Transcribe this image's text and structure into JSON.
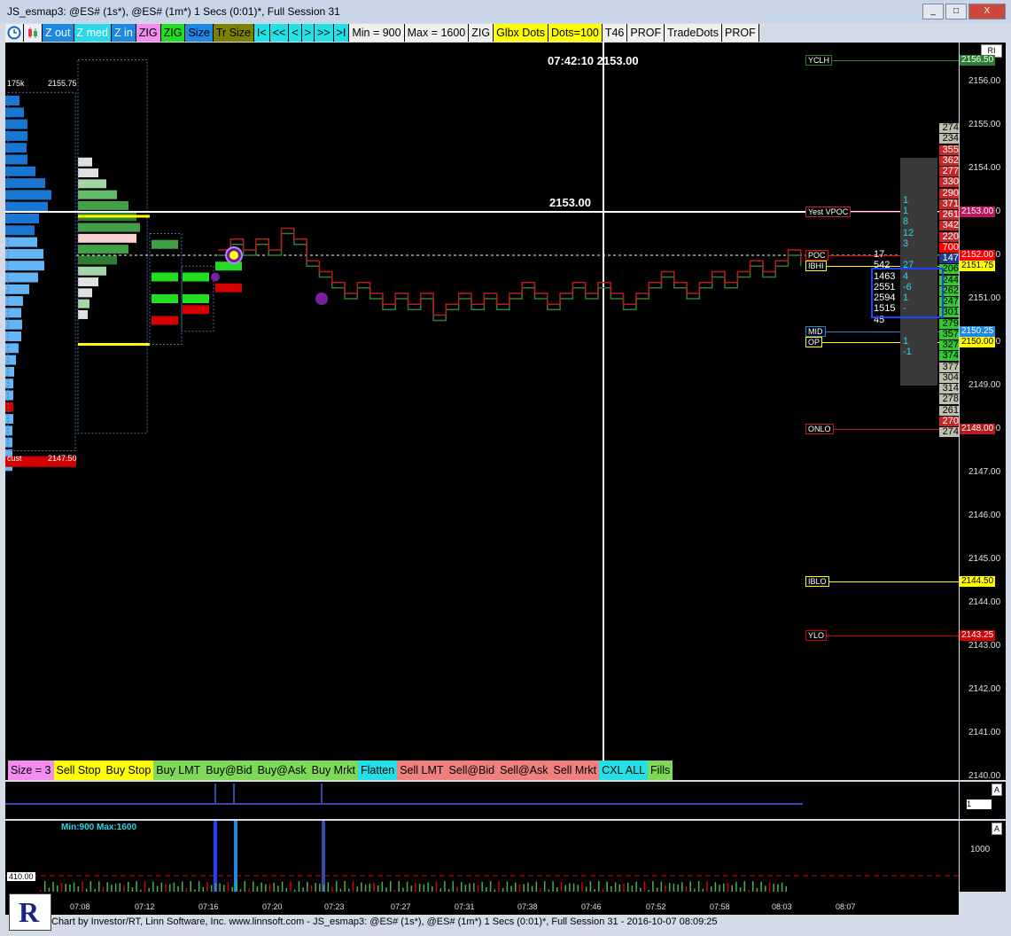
{
  "window": {
    "title": "JS_esmap3: @ES# (1s*), @ES# (1m*) 1 Secs (0:01)*, Full Session 31",
    "minimize": "_",
    "maximize": "□",
    "close": "X"
  },
  "toolbar": {
    "items": [
      {
        "label": "Z out",
        "bg": "#1e88e5",
        "fg": "#fff"
      },
      {
        "label": "Z med",
        "bg": "#29d9e8",
        "fg": "#fff"
      },
      {
        "label": "Z in",
        "bg": "#1e88e5",
        "fg": "#fff"
      },
      {
        "label": "ZIG",
        "bg": "#f48cf0",
        "fg": "#000"
      },
      {
        "label": "ZIG",
        "bg": "#22dd22",
        "fg": "#000"
      },
      {
        "label": "Size",
        "bg": "#1e88e5",
        "fg": "#000"
      },
      {
        "label": "Tr Size",
        "bg": "#808000",
        "fg": "#000"
      },
      {
        "label": "I<",
        "bg": "#22e0e8",
        "fg": "#000"
      },
      {
        "label": "<<",
        "bg": "#22e0e8",
        "fg": "#000"
      },
      {
        "label": "<",
        "bg": "#22e0e8",
        "fg": "#000"
      },
      {
        "label": ">",
        "bg": "#22e0e8",
        "fg": "#000"
      },
      {
        "label": ">>",
        "bg": "#22e0e8",
        "fg": "#000"
      },
      {
        "label": ">I",
        "bg": "#22e0e8",
        "fg": "#000"
      },
      {
        "label": "Min = 900",
        "bg": "#f0f0f0",
        "fg": "#000"
      },
      {
        "label": "Max = 1600",
        "bg": "#f0f0f0",
        "fg": "#000"
      },
      {
        "label": "ZIG",
        "bg": "#f0f0f0",
        "fg": "#000"
      },
      {
        "label": "Glbx Dots",
        "bg": "#ffff00",
        "fg": "#000"
      },
      {
        "label": "Dots=100",
        "bg": "#ffff00",
        "fg": "#000"
      },
      {
        "label": "T46",
        "bg": "#f0f0f0",
        "fg": "#000"
      },
      {
        "label": "PROF",
        "bg": "#f0f0f0",
        "fg": "#000"
      },
      {
        "label": "TradeDots",
        "bg": "#f0f0f0",
        "fg": "#000"
      },
      {
        "label": "PROF",
        "bg": "#f0f0f0",
        "fg": "#000"
      }
    ]
  },
  "chart": {
    "clock_readout": "07:42:10  2153.00",
    "crosshair_price": "2153.00",
    "profile_top_left": "175k",
    "profile_top_price": "2155.75",
    "profile_bottom_left": "cust",
    "profile_bottom_price": "2147.50",
    "price_ticks": [
      "2156.00",
      "2155.00",
      "2154.00",
      "2153.00",
      "2152.00",
      "2151.00",
      "2150.00",
      "2149.00",
      "2148.00",
      "2147.00",
      "2146.00",
      "2145.00",
      "2144.00",
      "2143.00",
      "2142.00",
      "2141.00",
      "2140.00"
    ],
    "axis_mode": "RI",
    "levels": [
      {
        "name": "YCLH",
        "price": "2156.50",
        "color": "#2e7d32"
      },
      {
        "name": "Yest VPOC",
        "price": "2153.00",
        "color": "#c2185b"
      },
      {
        "name": "POC",
        "price": "2152.00",
        "color": "#ff0000"
      },
      {
        "name": "IBHI",
        "price": "2151.75",
        "color": "#ffff00"
      },
      {
        "name": "MID",
        "price": "2150.25",
        "color": "#1e88e5"
      },
      {
        "name": "OP",
        "price": "2150.00",
        "color": "#ffff00"
      },
      {
        "name": "ONLO",
        "price": "2148.00",
        "color": "#b71c1c"
      },
      {
        "name": "IBLO",
        "price": "2144.50",
        "color": "#ffff00"
      },
      {
        "name": "YLO",
        "price": "2143.25",
        "color": "#d50000"
      }
    ],
    "dom_bids": [
      "274",
      "234",
      "355",
      "362",
      "277",
      "330",
      "290",
      "371",
      "261",
      "342",
      "220",
      "700",
      "147",
      "206",
      "244",
      "262",
      "247",
      "301",
      "279",
      "357",
      "327",
      "374",
      "377",
      "304",
      "314",
      "278",
      "261",
      "270",
      "274"
    ],
    "dom_delta": [
      "1",
      "1",
      "8",
      "12",
      "3",
      "27",
      "4",
      "-6",
      "1",
      "-",
      "1",
      "-1"
    ],
    "dom_volume": [
      "17",
      "542",
      "1463",
      "2551",
      "2594",
      "1515",
      "45"
    ]
  },
  "order_buttons": [
    {
      "label": "Size = 3",
      "bg": "#f48cf0"
    },
    {
      "label": "Sell Stop",
      "bg": "#ffff00"
    },
    {
      "label": "Buy Stop",
      "bg": "#ffff00"
    },
    {
      "label": "Buy LMT",
      "bg": "#7ed957"
    },
    {
      "label": "Buy@Bid",
      "bg": "#7ed957"
    },
    {
      "label": "Buy@Ask",
      "bg": "#7ed957"
    },
    {
      "label": "Buy Mrkt",
      "bg": "#7ed957"
    },
    {
      "label": "Flatten",
      "bg": "#22e0e8"
    },
    {
      "label": "Sell LMT",
      "bg": "#f08080"
    },
    {
      "label": "Sell@Bid",
      "bg": "#f08080"
    },
    {
      "label": "Sell@Ask",
      "bg": "#f08080"
    },
    {
      "label": "Sell Mrkt",
      "bg": "#f08080"
    },
    {
      "label": "CXL ALL",
      "bg": "#22e0e8"
    },
    {
      "label": "Fills",
      "bg": "#7ed957"
    }
  ],
  "sub1": {
    "axis_btn": "A",
    "value": "1"
  },
  "sub2": {
    "label": "Min:900 Max:1600",
    "axis_btn": "A",
    "tick": "1000",
    "ref_value": "410.00"
  },
  "time_labels": [
    "07:08",
    "07:12",
    "07:16",
    "07:20",
    "07:23",
    "07:27",
    "07:31",
    "07:38",
    "07:46",
    "07:52",
    "07:58",
    "08:03",
    "08:07"
  ],
  "footer": "Chart by Investor/RT, Linn Software, Inc. www.linnsoft.com - JS_esmap3: @ES# (1s*), @ES# (1m*) 1 Secs (0:01)*, Full Session 31 - 2016-10-07 08:09:25",
  "logo_letter": "R"
}
